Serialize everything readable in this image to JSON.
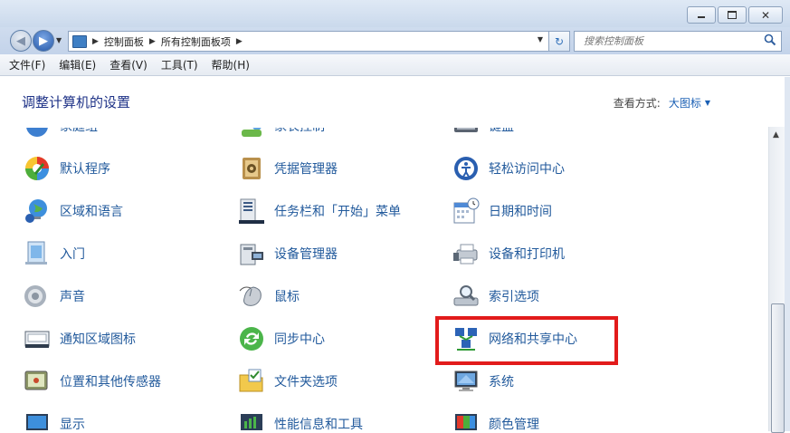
{
  "window": {
    "controls": [
      "minimize",
      "maximize",
      "close"
    ]
  },
  "address": {
    "breadcrumbs": [
      "控制面板",
      "所有控制面板项"
    ],
    "search_placeholder": "搜索控制面板"
  },
  "menu": [
    "文件(F)",
    "编辑(E)",
    "查看(V)",
    "工具(T)",
    "帮助(H)"
  ],
  "content": {
    "heading": "调整计算机的设置",
    "view_by_label": "查看方式:",
    "view_by_value": "大图标",
    "items": [
      {
        "label": "家庭组",
        "icon": "homegroup-icon"
      },
      {
        "label": "家长控制",
        "icon": "parental-controls-icon"
      },
      {
        "label": "键盘",
        "icon": "keyboard-icon"
      },
      {
        "label": "默认程序",
        "icon": "default-programs-icon"
      },
      {
        "label": "凭据管理器",
        "icon": "credential-manager-icon"
      },
      {
        "label": "轻松访问中心",
        "icon": "ease-of-access-icon"
      },
      {
        "label": "区域和语言",
        "icon": "region-language-icon"
      },
      {
        "label": "任务栏和「开始」菜单",
        "icon": "taskbar-start-menu-icon"
      },
      {
        "label": "日期和时间",
        "icon": "date-time-icon"
      },
      {
        "label": "入门",
        "icon": "getting-started-icon"
      },
      {
        "label": "设备管理器",
        "icon": "device-manager-icon"
      },
      {
        "label": "设备和打印机",
        "icon": "devices-printers-icon"
      },
      {
        "label": "声音",
        "icon": "sound-icon"
      },
      {
        "label": "鼠标",
        "icon": "mouse-icon"
      },
      {
        "label": "索引选项",
        "icon": "indexing-options-icon"
      },
      {
        "label": "通知区域图标",
        "icon": "notification-area-icon"
      },
      {
        "label": "同步中心",
        "icon": "sync-center-icon"
      },
      {
        "label": "网络和共享中心",
        "icon": "network-sharing-icon"
      },
      {
        "label": "位置和其他传感器",
        "icon": "location-sensors-icon"
      },
      {
        "label": "文件夹选项",
        "icon": "folder-options-icon"
      },
      {
        "label": "系统",
        "icon": "system-icon"
      },
      {
        "label": "显示",
        "icon": "display-icon"
      },
      {
        "label": "性能信息和工具",
        "icon": "performance-tools-icon"
      },
      {
        "label": "颜色管理",
        "icon": "color-management-icon"
      }
    ]
  },
  "colors": {
    "link": "#225a9c",
    "heading": "#1e3287",
    "highlight": "#e21b1b"
  }
}
